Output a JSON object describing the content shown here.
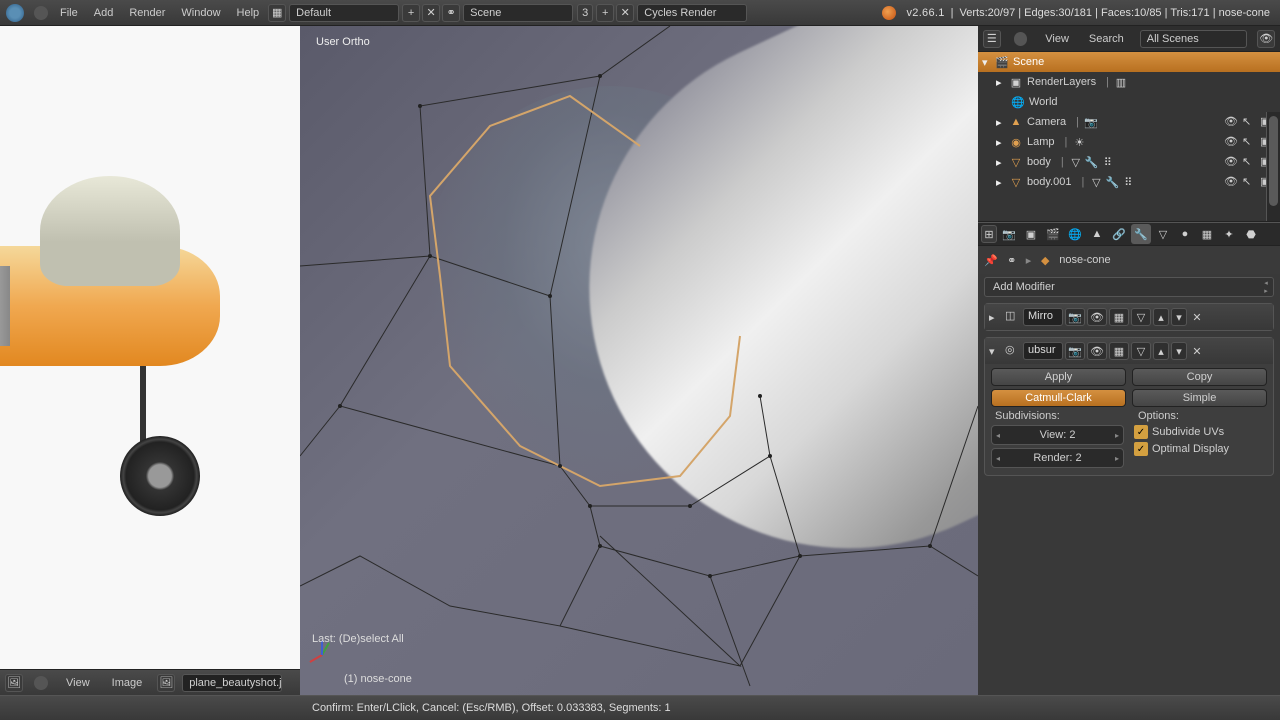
{
  "topbar": {
    "menus": [
      "File",
      "Add",
      "Render",
      "Window",
      "Help"
    ],
    "layout": "Default",
    "scene": "Scene",
    "scene_count": "3",
    "engine": "Cycles Render",
    "version": "v2.66.1",
    "stats": "Verts:20/97 | Edges:30/181 | Faces:10/85 | Tris:171 | nose-cone"
  },
  "outliner_header": {
    "view": "View",
    "search": "Search",
    "filter": "All Scenes"
  },
  "outliner": {
    "scene": "Scene",
    "items": [
      {
        "name": "RenderLayers"
      },
      {
        "name": "World"
      },
      {
        "name": "Camera"
      },
      {
        "name": "Lamp"
      },
      {
        "name": "body"
      },
      {
        "name": "body.001"
      }
    ]
  },
  "breadcrumb": {
    "object": "nose-cone"
  },
  "add_modifier": "Add Modifier",
  "modifiers": {
    "mirror": {
      "name": "Mirro"
    },
    "subsurf": {
      "name": "ubsur",
      "apply": "Apply",
      "copy": "Copy",
      "catmull": "Catmull-Clark",
      "simple": "Simple",
      "subdivisions_label": "Subdivisions:",
      "options_label": "Options:",
      "view": "View: 2",
      "render": "Render: 2",
      "subdivide_uvs": "Subdivide UVs",
      "optimal_display": "Optimal Display"
    }
  },
  "viewport": {
    "projection": "User Ortho",
    "last_op": "Last: (De)select All",
    "object_label": "(1) nose-cone"
  },
  "imgeditor": {
    "view": "View",
    "image": "Image",
    "filename": "plane_beautyshot.j"
  },
  "status": "Confirm: Enter/LClick, Cancel: (Esc/RMB), Offset: 0.033383, Segments: 1"
}
